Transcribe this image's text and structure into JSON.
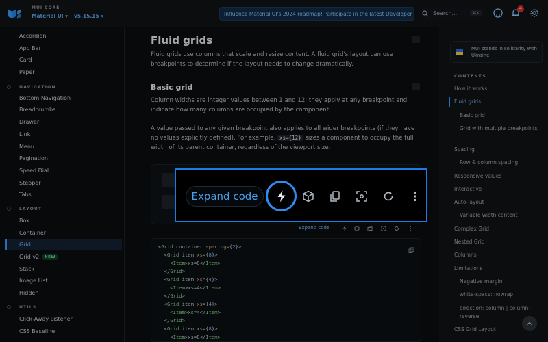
{
  "header": {
    "brand_small": "MUI CORE",
    "product_select": "Material UI ▾",
    "version_select": "v5.15.15 ▾",
    "banner": "Influence Material UI's 2024 roadmap! Participate in the latest Developer Survey",
    "search_placeholder": "Search...",
    "search_shortcut": "⌘K",
    "notifications_count": "4",
    "icons": [
      "search-icon",
      "github-icon",
      "bell-icon",
      "gear-icon"
    ]
  },
  "sidebar": {
    "items_top": [
      "Accordion",
      "App Bar",
      "Card",
      "Paper"
    ],
    "sections": [
      "NAVIGATION",
      "LAYOUT",
      "UTILS"
    ],
    "navigation": [
      "Bottom Navigation",
      "Breadcrumbs",
      "Drawer",
      "Link",
      "Menu",
      "Pagination",
      "Speed Dial",
      "Stepper",
      "Tabs"
    ],
    "layout": [
      "Box",
      "Container",
      "Grid",
      "Grid v2",
      "Stack",
      "Image List",
      "Hidden"
    ],
    "layout_new_badge": "NEW",
    "active_item": "Grid",
    "utils": [
      "Click-Away Listener",
      "CSS Baseline"
    ]
  },
  "main": {
    "title": "Fluid grids",
    "intro": "Fluid grids use columns that scale and resize content. A fluid grid's layout can use breakpoints to determine if the layout needs to change dramatically.",
    "subtitle": "Basic grid",
    "p1": "Column widths are integer values between 1 and 12; they apply at any breakpoint and indicate how many columns are occupied by the component.",
    "p2_a": "A value passed to any given breakpoint also applies to all wider breakpoints (if they have no values explicitly defined). For example,",
    "p2_code": "xs={12}",
    "p2_b": "sizes a component to occupy the full width of its parent container, regardless of the viewport size.",
    "mini_expand": "Expand code",
    "code_lines": [
      "<Grid container spacing={2}>",
      "  <Grid item xs={8}>",
      "    <Item>xs=8</Item>",
      "  </Grid>",
      "  <Grid item xs={4}>",
      "    <Item>xs=4</Item>",
      "  </Grid>",
      "  <Grid item xs={4}>",
      "    <Item>xs=4</Item>",
      "  </Grid>",
      "  <Grid item xs={8}>",
      "    <Item>xs=8</Item>"
    ]
  },
  "zoom": {
    "expand_label": "Expand code",
    "icons": [
      "bolt-icon",
      "cube-icon",
      "copy-icon",
      "screenshot-icon",
      "refresh-icon",
      "more-vert-icon"
    ]
  },
  "toc": {
    "ukraine_text": "MUI stands in solidarity with Ukraine.",
    "title": "CONTENTS",
    "items": [
      {
        "label": "How it works",
        "level": 1
      },
      {
        "label": "Fluid grids",
        "level": 1,
        "active": true
      },
      {
        "label": "Basic grid",
        "level": 2
      },
      {
        "label": "Grid with multiple breakpoints",
        "level": 2
      },
      {
        "label": "Spacing",
        "level": 1
      },
      {
        "label": "Row & column spacing",
        "level": 2
      },
      {
        "label": "Responsive values",
        "level": 1
      },
      {
        "label": "Interactive",
        "level": 1
      },
      {
        "label": "Auto-layout",
        "level": 1
      },
      {
        "label": "Variable width content",
        "level": 2
      },
      {
        "label": "Complex Grid",
        "level": 1
      },
      {
        "label": "Nested Grid",
        "level": 1
      },
      {
        "label": "Columns",
        "level": 1
      },
      {
        "label": "Limitations",
        "level": 1
      },
      {
        "label": "Negative margin",
        "level": 2
      },
      {
        "label": "white-space: nowrap",
        "level": 2
      },
      {
        "label": "direction: column | column-reverse",
        "level": 2
      },
      {
        "label": "CSS Grid Layout",
        "level": 1
      }
    ]
  },
  "colors": {
    "accent": "#3399ff",
    "zoom_border": "#1f7ae0",
    "code_tag": "#7fd67f"
  }
}
